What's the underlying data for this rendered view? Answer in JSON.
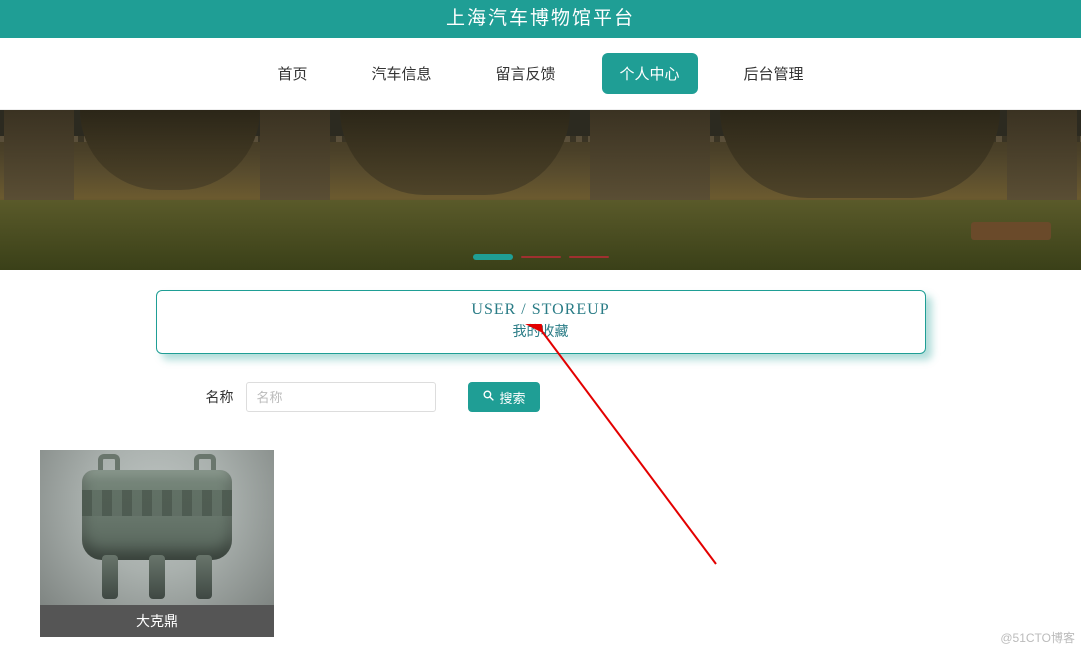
{
  "header": {
    "title": "上海汽车博物馆平台"
  },
  "nav": {
    "items": [
      {
        "label": "首页",
        "active": false
      },
      {
        "label": "汽车信息",
        "active": false
      },
      {
        "label": "留言反馈",
        "active": false
      },
      {
        "label": "个人中心",
        "active": true
      },
      {
        "label": "后台管理",
        "active": false
      }
    ]
  },
  "carousel": {
    "dots": 3,
    "active_index": 0
  },
  "section": {
    "title_en": "USER / STOREUP",
    "title_cn": "我的收藏"
  },
  "search": {
    "label": "名称",
    "placeholder": "名称",
    "button_label": "搜索"
  },
  "items": [
    {
      "title": "大克鼎"
    }
  ],
  "watermark": "@51CTO博客"
}
